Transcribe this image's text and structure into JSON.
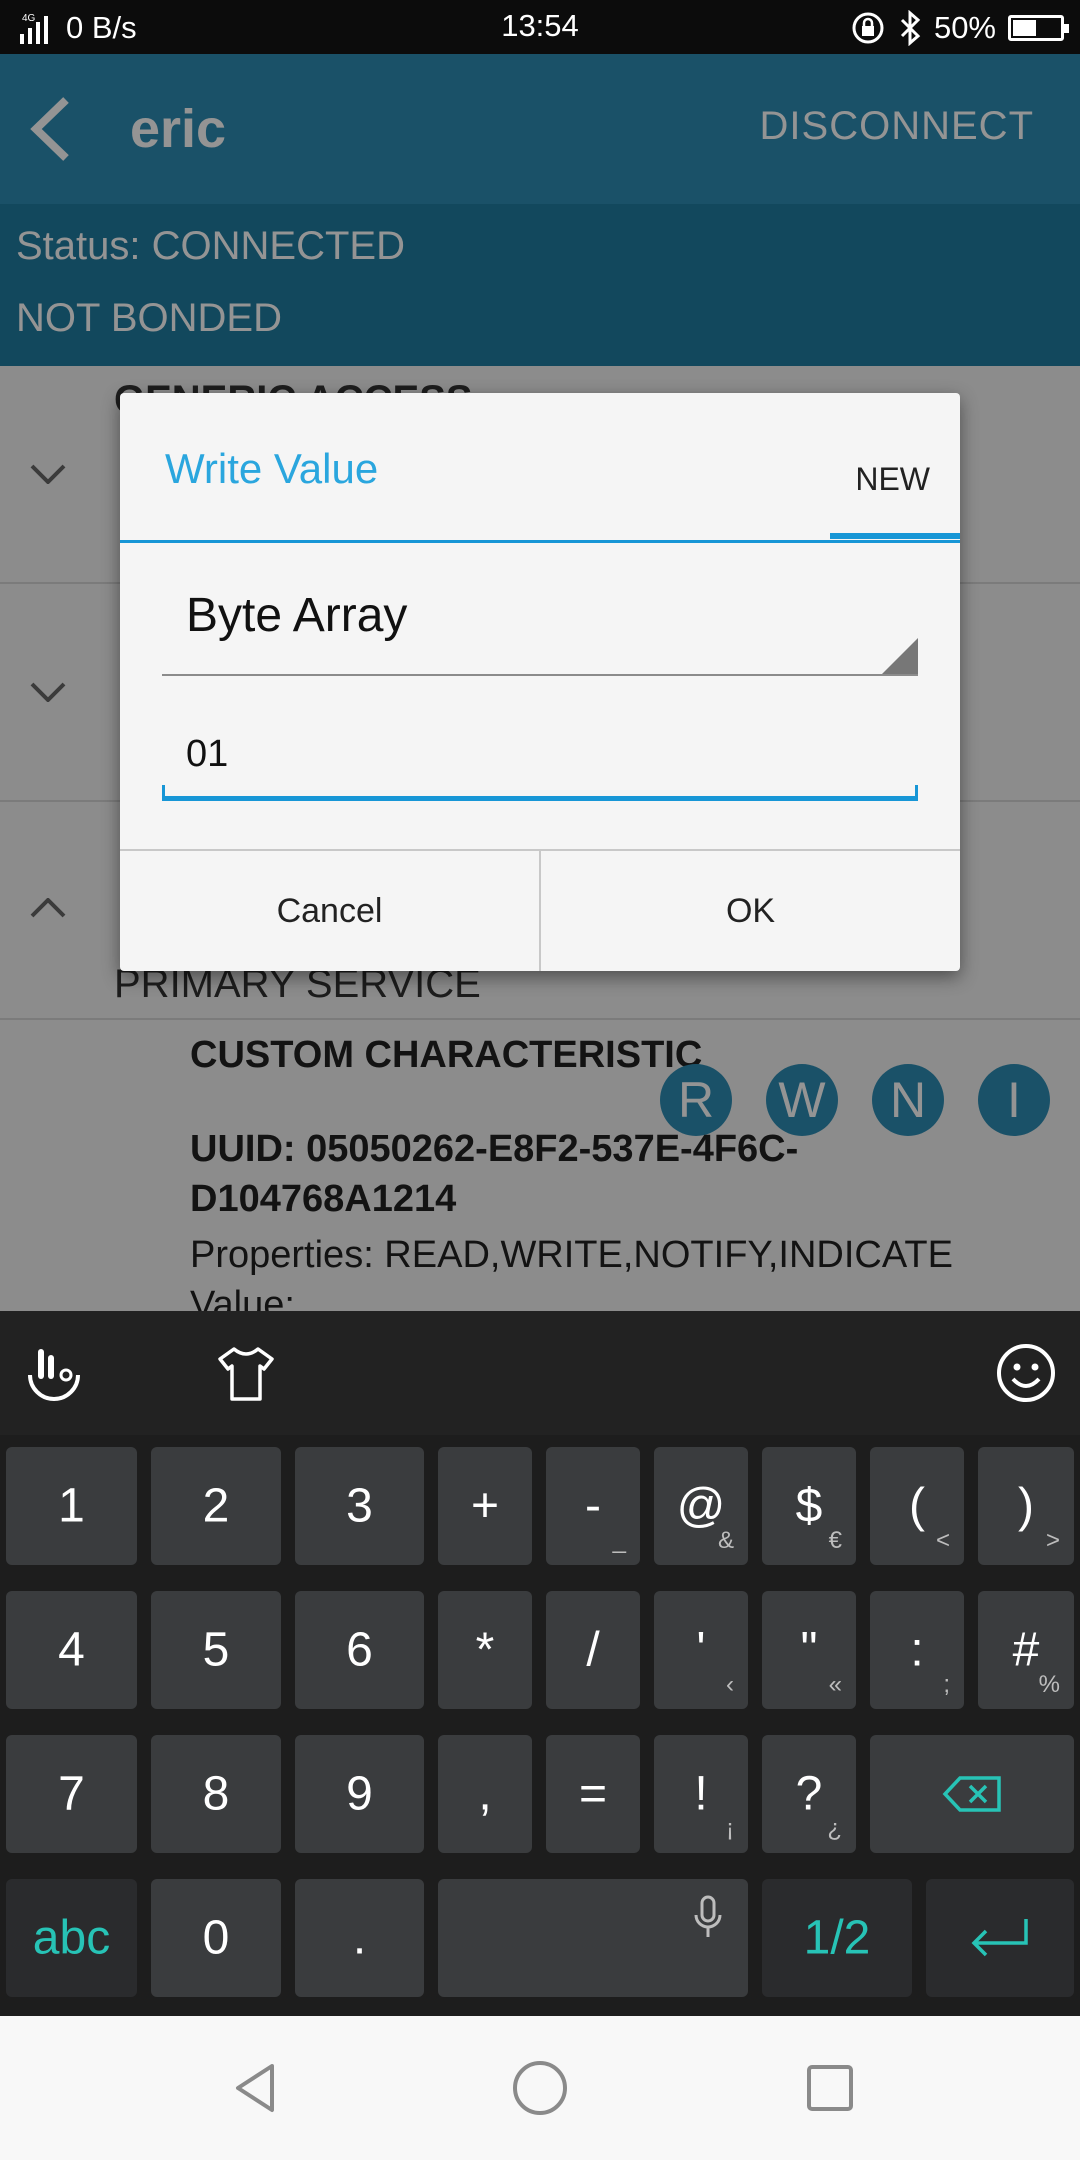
{
  "status_bar": {
    "network": "4G",
    "speed": "0 B/s",
    "time": "13:54",
    "battery": "50%",
    "battery_level": 0.5
  },
  "app": {
    "toolbar": {
      "title": "eric",
      "action": "DISCONNECT"
    },
    "status": {
      "line1": "Status: CONNECTED",
      "line2": "NOT BONDED"
    },
    "service_title_partial": "GENERIC ACCESS",
    "primary_service": "PRIMARY SERVICE",
    "characteristic": {
      "title": "CUSTOM CHARACTERISTIC",
      "uuid": "UUID: 05050262-E8F2-537E-4F6C-D104768A1214",
      "properties": "Properties: READ,WRITE,NOTIFY,INDICATE",
      "value": "Value:",
      "badges": [
        "R",
        "W",
        "N",
        "I"
      ]
    }
  },
  "dialog": {
    "title": "Write Value",
    "tab": "NEW",
    "format": "Byte Array",
    "input_value": "01",
    "cancel": "Cancel",
    "ok": "OK"
  },
  "keyboard": {
    "rows": [
      [
        {
          "m": "1",
          "s": ""
        },
        {
          "m": "2",
          "s": ""
        },
        {
          "m": "3",
          "s": ""
        },
        {
          "m": "+",
          "s": ""
        },
        {
          "m": "-",
          "s": "_"
        },
        {
          "m": "@",
          "s": "&"
        },
        {
          "m": "$",
          "s": "€"
        },
        {
          "m": "(",
          "s": "<"
        },
        {
          "m": ")",
          "s": ">"
        }
      ],
      [
        {
          "m": "4",
          "s": ""
        },
        {
          "m": "5",
          "s": ""
        },
        {
          "m": "6",
          "s": ""
        },
        {
          "m": "*",
          "s": ""
        },
        {
          "m": "/",
          "s": ""
        },
        {
          "m": "'",
          "s": "‹"
        },
        {
          "m": "\"",
          "s": "«"
        },
        {
          "m": ":",
          "s": ";"
        },
        {
          "m": "#",
          "s": "%"
        }
      ],
      [
        {
          "m": "7",
          "s": ""
        },
        {
          "m": "8",
          "s": ""
        },
        {
          "m": "9",
          "s": ""
        },
        {
          "m": ",",
          "s": ""
        },
        {
          "m": "=",
          "s": ""
        },
        {
          "m": "!",
          "s": "¡"
        },
        {
          "m": "?",
          "s": "¿"
        }
      ]
    ],
    "bottom": {
      "abc": "abc",
      "zero": "0",
      "dot": ".",
      "page": "1/2"
    }
  }
}
